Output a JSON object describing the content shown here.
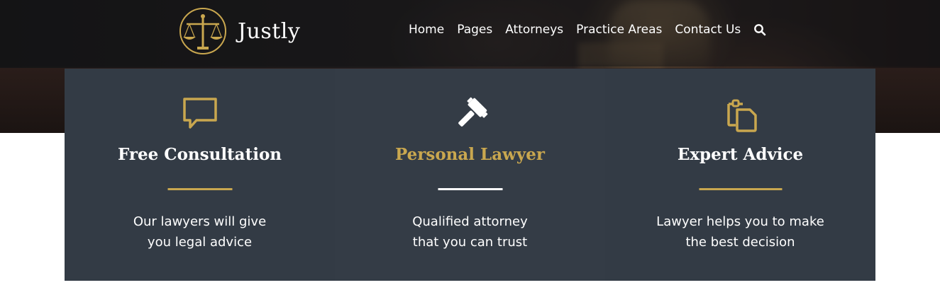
{
  "brand": {
    "name": "Justly",
    "logo_icon": "scales-of-justice-icon"
  },
  "nav": {
    "items": [
      {
        "label": "Home"
      },
      {
        "label": "Pages"
      },
      {
        "label": "Attorneys"
      },
      {
        "label": "Practice Areas"
      },
      {
        "label": "Contact Us"
      }
    ],
    "search_icon": "search-icon"
  },
  "features": [
    {
      "icon": "chat-bubble-icon",
      "title": "Free Consultation",
      "text_line1": "Our lawyers will give",
      "text_line2": "you legal advice"
    },
    {
      "icon": "gavel-icon",
      "title": "Personal Lawyer",
      "text_line1": "Qualified attorney",
      "text_line2": "that you can trust"
    },
    {
      "icon": "clipboard-copy-icon",
      "title": "Expert Advice",
      "text_line1": "Lawyer helps you to make",
      "text_line2": "the best decision"
    }
  ],
  "colors": {
    "accent": "#c9a74f",
    "card": "#333b45",
    "header": "#1a1a1c"
  }
}
